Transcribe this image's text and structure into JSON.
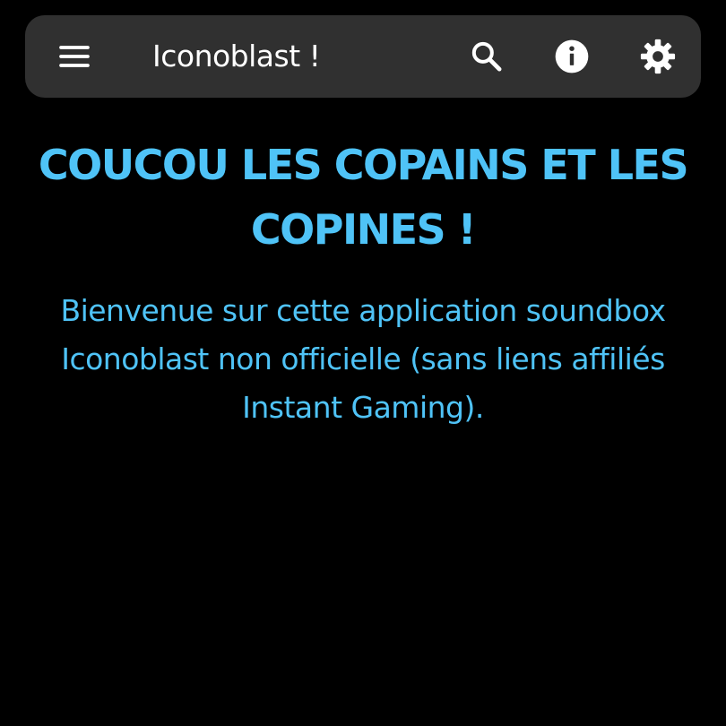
{
  "app_bar": {
    "title": "Iconoblast !",
    "icons": {
      "menu": "menu-icon",
      "search": "search-icon",
      "info": "info-icon",
      "settings": "gear-icon"
    }
  },
  "main": {
    "headline": "COUCOU LES COPAINS ET LES COPINES !",
    "subtitle": "Bienvenue sur cette application soundbox Iconoblast non officielle (sans liens affiliés Instant Gaming)."
  },
  "colors": {
    "background": "#000000",
    "toolbar": "#303030",
    "accent": "#4fc3f7",
    "toolbar_text": "#ffffff"
  }
}
